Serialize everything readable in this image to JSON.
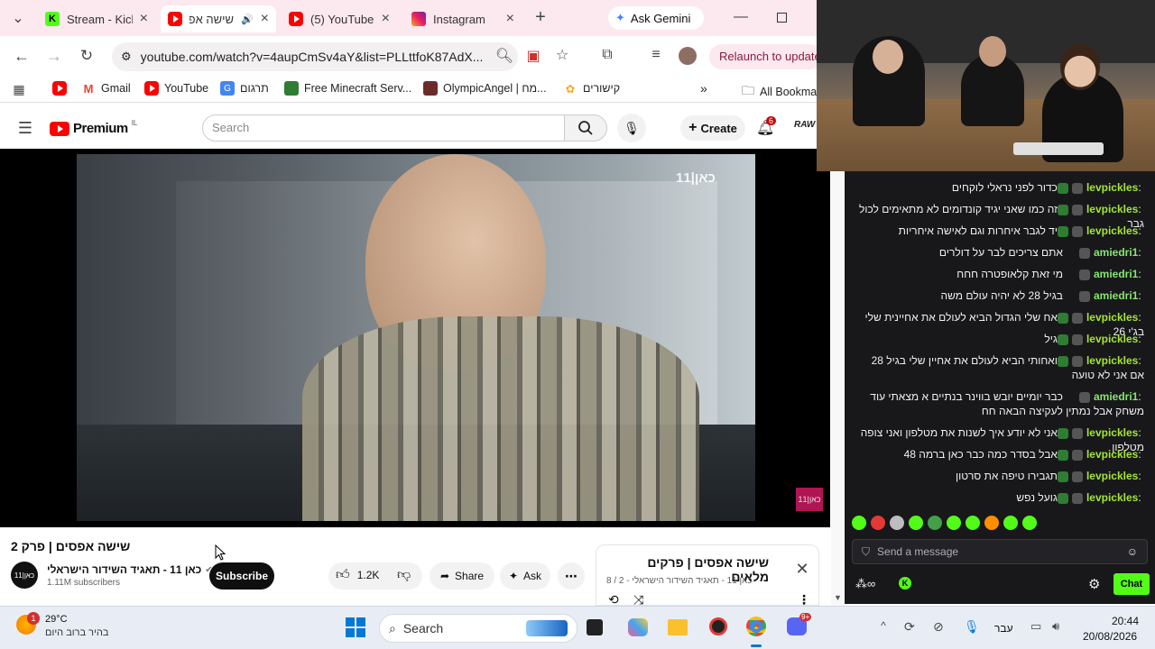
{
  "browser": {
    "tabs": [
      {
        "label": "Stream - Kick",
        "icon": "kick-icon"
      },
      {
        "label": "שישה אפסים",
        "icon": "youtube-icon",
        "active": true
      },
      {
        "label": "(5) YouTube",
        "icon": "youtube-icon"
      },
      {
        "label": "Instagram",
        "icon": "instagram-icon"
      }
    ],
    "new_tab": "+",
    "gemini": "Ask Gemini",
    "url": "youtube.com/watch?v=4aupCmSv4aY&list=PLLttfoK87AdX...",
    "relaunch": "Relaunch to update",
    "bookmarks": [
      "Gmail",
      "YouTube",
      "תרגום",
      "Free Minecraft Serv...",
      "OlympicAngel | מח...",
      "קישורים"
    ],
    "all_bookmarks": "All Bookma"
  },
  "youtube": {
    "logo": "Premium",
    "logo_sup": "IL",
    "search_placeholder": "Search",
    "create": "Create",
    "notif_count": "6",
    "video_title": "שישה אפסים | פרק 2",
    "channel_name": "כאן 11 - תאגיד השידור הישראלי",
    "subscribers": "1.11M subscribers",
    "subscribe": "Subscribe",
    "likes": "1.2K",
    "share": "Share",
    "ask": "Ask",
    "watermark": "11|כאן",
    "playlist_title": "שישה אפסים | פרקים מלאים",
    "playlist_sub": "כאן 11 - תאגיד השידור הישראלי - 2 / 8"
  },
  "chat": {
    "messages": [
      {
        "user": "levpickles",
        "text": "כדור לפני נראלי לוקחים"
      },
      {
        "user": "levpickles",
        "text": "זה כמו שאני יגיד קונדומים לא מתאימים לכול גבר"
      },
      {
        "user": "levpickles",
        "text": "יד לגבר איחרות וגם לאישה איחריות"
      },
      {
        "user": "amiedri1",
        "text": "אתם צריכים לבר על דולרים"
      },
      {
        "user": "amiedri1",
        "text": "מי זאת קלאופטרה חחח"
      },
      {
        "user": "amiedri1",
        "text": "בגיל 28 לא יהיה עולם משה"
      },
      {
        "user": "levpickles",
        "text": "אח שלי הגדול הביא לעולם את אחיינית שלי בג'י 26"
      },
      {
        "user": "levpickles",
        "text": "גיל"
      },
      {
        "user": "levpickles",
        "text": "ואחותי הביא לעולם את אחיין שלי בגיל 28 אם אני לא טועה"
      },
      {
        "user": "amiedri1",
        "text": "כבר יומיים יובש בווינר בנתיים א מצאתי עוד משחק אבל נמתין לעקיצה הבאה חח"
      },
      {
        "user": "levpickles",
        "text": "אני לא יודע איך לשנות את מטלפון ואני צופה מטלפון"
      },
      {
        "user": "levpickles",
        "text": "אבל בסדר כמה כבר כאן ברמה 48"
      },
      {
        "user": "levpickles",
        "text": "תגבירו טיפה את סרטון"
      },
      {
        "user": "levpickles",
        "text": "גועל נפש"
      }
    ],
    "input_placeholder": "Send a message",
    "chat_button": "Chat"
  },
  "taskbar": {
    "weather_badge": "1",
    "temperature": "29°C",
    "weather_text": "בהיר ברוב היום",
    "search": "Search",
    "lang": "עבר",
    "time": "20:44",
    "date": "20/08/2026",
    "discord_badge": "9+"
  }
}
